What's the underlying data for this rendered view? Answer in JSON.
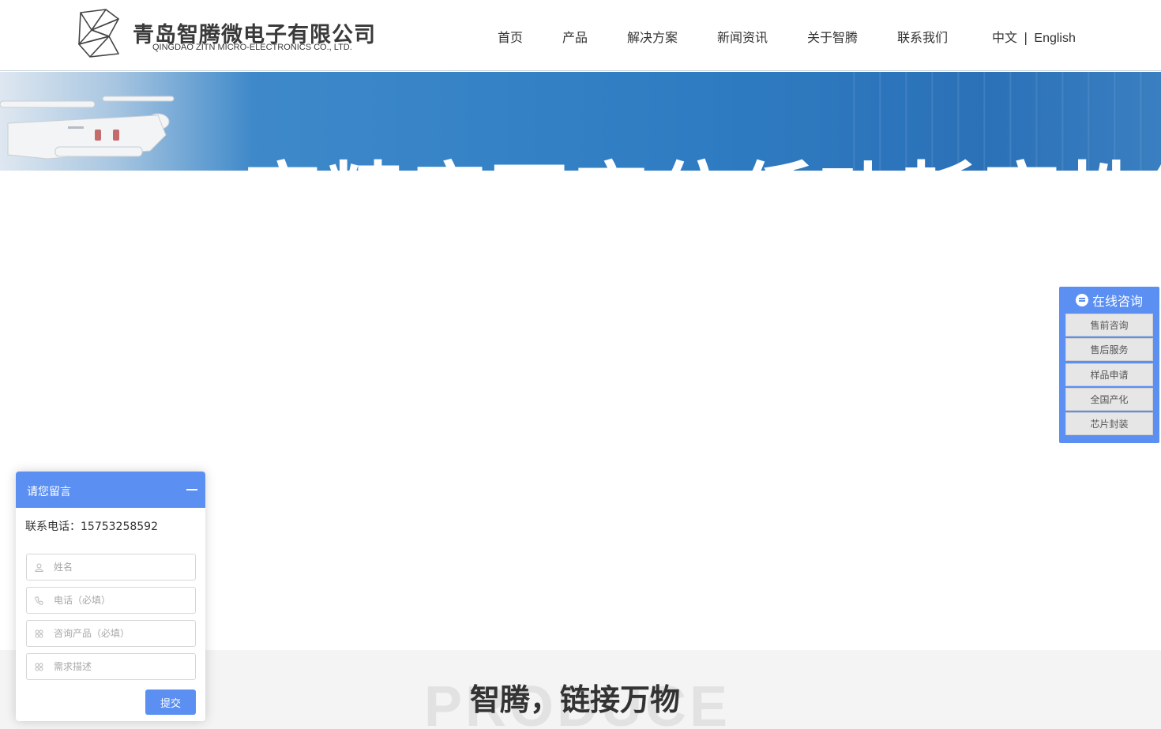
{
  "logo": {
    "cn": "青岛智腾微电子有限公司",
    "en": "QINGDAO ZITN MICRO-ELECTRONICS CO., LTD."
  },
  "nav": {
    "items": [
      {
        "label": "首页"
      },
      {
        "label": "产品"
      },
      {
        "label": "解决方案"
      },
      {
        "label": "新闻资讯"
      },
      {
        "label": "关于智腾"
      },
      {
        "label": "联系我们"
      }
    ]
  },
  "lang": {
    "zh": "中文",
    "sep": "|",
    "en": "English"
  },
  "banner": {
    "headline": "高精度可定位低功耗高性能"
  },
  "consult": {
    "title": "在线咨询",
    "items": [
      {
        "label": "售前咨询"
      },
      {
        "label": "售后服务"
      },
      {
        "label": "样品申请"
      },
      {
        "label": "全国产化"
      },
      {
        "label": "芯片封装"
      }
    ]
  },
  "message": {
    "title": "请您留言",
    "phone": "联系电话：15753258592",
    "fields": {
      "name": {
        "placeholder": "姓名",
        "value": ""
      },
      "tel": {
        "placeholder": "电话（必填）",
        "value": ""
      },
      "product": {
        "placeholder": "咨询产品（必填）",
        "value": ""
      },
      "desc": {
        "placeholder": "需求描述",
        "value": ""
      }
    },
    "submit": "提交"
  },
  "section": {
    "bg_text": "PRODUCE",
    "title": "智腾，链接万物"
  },
  "colors": {
    "accent": "#5b8ff2",
    "banner": "#2f7cc2",
    "text": "#333333"
  }
}
